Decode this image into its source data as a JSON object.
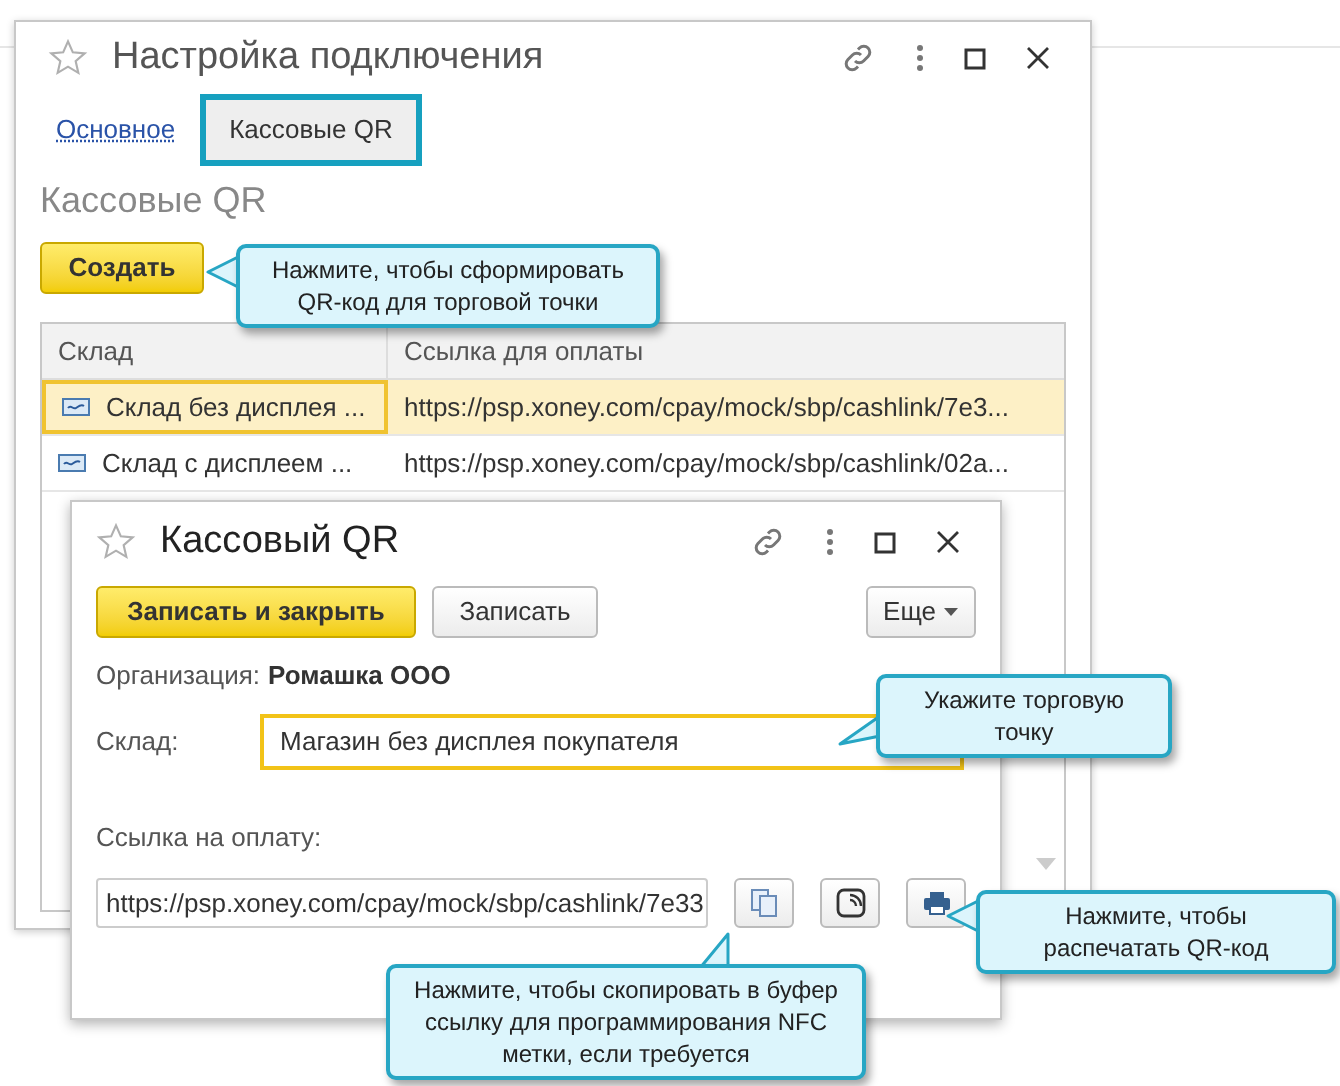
{
  "back_window": {
    "title": "Настройка подключения",
    "tabs": [
      {
        "label": "Основное",
        "selected": false
      },
      {
        "label": "Кассовые QR",
        "selected": true
      }
    ],
    "section_title": "Кассовые QR",
    "create_button": "Создать",
    "table": {
      "columns": [
        "Склад",
        "Ссылка для оплаты"
      ],
      "rows": [
        {
          "cells": [
            "Склад без дисплея ...",
            "https://psp.xoney.com/cpay/mock/sbp/cashlink/7e3..."
          ],
          "selected": true
        },
        {
          "cells": [
            "Склад с дисплеем ...",
            "https://psp.xoney.com/cpay/mock/sbp/cashlink/02a..."
          ],
          "selected": false
        }
      ]
    }
  },
  "dialog": {
    "title": "Кассовый QR",
    "buttons": [
      {
        "label": "Записать и закрыть",
        "kind": "primary"
      },
      {
        "label": "Записать",
        "kind": "default"
      },
      {
        "label": "Еще",
        "kind": "menu"
      }
    ],
    "organization": {
      "label": "Организация:",
      "value": "Ромашка ООО"
    },
    "warehouse": {
      "label": "Склад:",
      "value": "Магазин без дисплея покупателя"
    },
    "link": {
      "label": "Ссылка на оплату:",
      "value": "https://psp.xoney.com/cpay/mock/sbp/cashlink/7e33"
    }
  },
  "callouts": [
    {
      "text": "Нажмите, чтобы сформировать QR-код для торговой точки"
    },
    {
      "text": "Укажите торговую точку"
    },
    {
      "text": "Нажмите, чтобы распечатать QR-код"
    },
    {
      "text": "Нажмите, чтобы скопировать в буфер ссылку для программирования NFC метки, если требуется"
    }
  ]
}
